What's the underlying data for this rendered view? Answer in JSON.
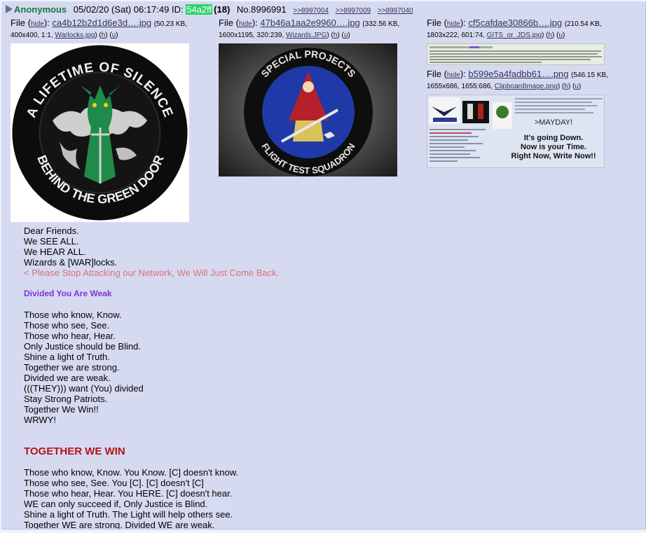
{
  "post": {
    "name": "Anonymous",
    "date": "05/02/20 (Sat) 06:17:49",
    "id_label": "ID:",
    "id_value": "54a2ff",
    "id_color": "#2bd46a",
    "count": "(18)",
    "number": "No.8996991",
    "backlinks": [
      ">>8997004",
      ">>8997009",
      ">>8997040"
    ]
  },
  "files": [
    {
      "label": "File",
      "hide": "hide",
      "name": "ca4b12b2d1d6e3d….jpg",
      "meta_prefix": "(50.23 KB,",
      "meta_dims": "400x400, 1:1,",
      "orig": "Warlocks.jpg",
      "h": "h",
      "u": "u",
      "thumb_text_top": "A LIFETIME OF SILENCE",
      "thumb_text_bottom": "BEHIND THE GREEN DOOR"
    },
    {
      "label": "File",
      "hide": "hide",
      "name": "47b46a1aa2e9960….jpg",
      "meta_prefix": "(332.56 KB,",
      "meta_dims": "1600x1195, 320:239,",
      "orig": "Wizards.JPG",
      "h": "h",
      "u": "u",
      "thumb_text_top": "SPECIAL PROJECTS",
      "thumb_text_bottom": "FLIGHT TEST SQUADRON"
    },
    {
      "label": "File",
      "hide": "hide",
      "name": "cf5cafdae30866b….jpg",
      "meta_prefix": "(210.54 KB,",
      "meta_dims": "1803x222, 601:74,",
      "orig": "GITS_or_JDS.jpg",
      "h": "h",
      "u": "u"
    },
    {
      "label": "File",
      "hide": "hide",
      "name": "b599e5a4fadbb61….png",
      "meta_prefix": "(546.15 KB,",
      "meta_dims": "1655x686, 1655:686,",
      "orig": "ClipboardImage.png",
      "h": "h",
      "u": "u",
      "thumb_mayday": ">MAYDAY!",
      "thumb_line1": "It's going Down.",
      "thumb_line2": "Now is your Time.",
      "thumb_line3": "Right Now, Write Now!!"
    }
  ],
  "message": {
    "block1": [
      "Dear Friends.",
      "We SEE ALL.",
      "We HEAR ALL.",
      "Wizards & [WAR]locks."
    ],
    "quote": "< Please Stop Attacking our Network, We Will Just Come Back.",
    "purple": "Divided You Are Weak",
    "block2": [
      "Those who know, Know.",
      "Those who see, See.",
      "Those who hear, Hear.",
      "Only Justice should be Blind.",
      "Shine a light of Truth.",
      "Together we are strong.",
      "Divided we are weak.",
      "(((THEY))) want (You) divided",
      "Stay Strong Patriots.",
      "Together We Win!!",
      "WRWY!"
    ],
    "heading": "TOGETHER WE WIN",
    "block3": [
      "Those who know, Know. You Know. [C] doesn't know.",
      "Those who see, See. You [C]. [C] doesn't [C]",
      "Those who hear, Hear. You HERE. [C] doesn't hear.",
      "WE can only succeed if, Only Justice is Blind.",
      "Shine a light of Truth. The Light will help others see.",
      "Together WE are strong. Divided WE are weak."
    ]
  }
}
